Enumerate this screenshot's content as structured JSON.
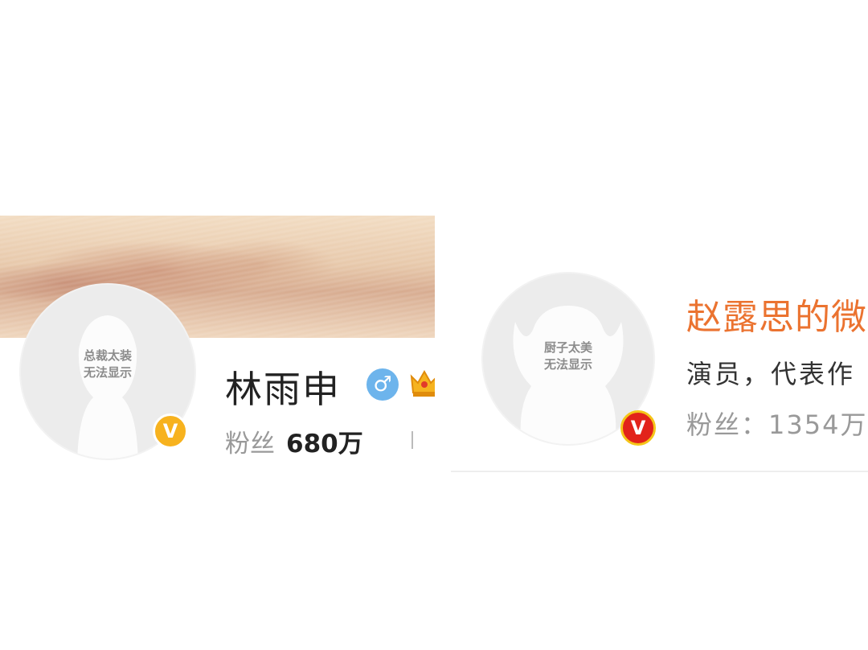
{
  "left_profile": {
    "avatar_placeholder": [
      "总裁太装",
      "无法显示"
    ],
    "verified_badge": "V",
    "name": "林雨申",
    "gender_symbol": "♂",
    "gender_icon": "male-icon",
    "crown_icon": "crown-icon",
    "fans_label": "粉丝",
    "fans_count": "680万",
    "badge_color": "#f7b21e"
  },
  "right_profile": {
    "avatar_placeholder": [
      "厨子太美",
      "无法显示"
    ],
    "verified_badge": "V",
    "name": "赵露思的微",
    "bio": "演员，代表作",
    "fans_label": "粉丝：",
    "fans_count": "1354万",
    "name_color": "#eb7330",
    "badge_color": "#e2231a"
  }
}
